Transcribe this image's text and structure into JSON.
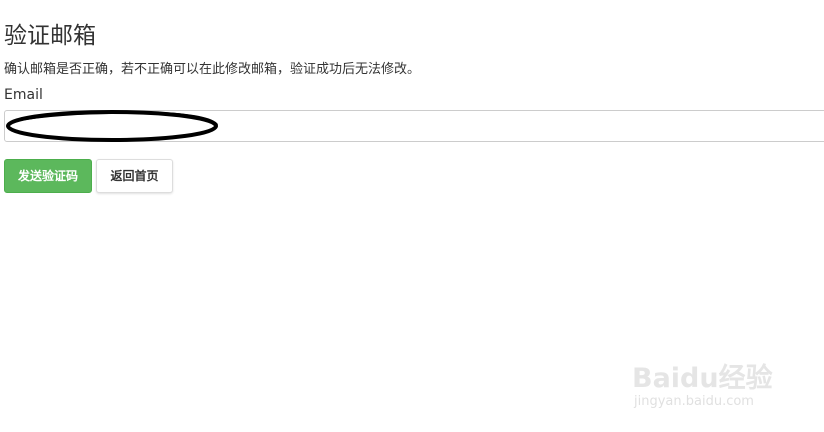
{
  "page": {
    "title": "验证邮箱",
    "description": "确认邮箱是否正确，若不正确可以在此修改邮箱，验证成功后无法修改。"
  },
  "form": {
    "email_label": "Email",
    "email_value": "",
    "email_placeholder": ""
  },
  "buttons": {
    "send_code": "发送验证码",
    "back_home": "返回首页"
  },
  "watermark": {
    "logo_text": "Baidu经验",
    "url_text": "jingyan.baidu.com"
  },
  "colors": {
    "primary_button": "#5cb85c",
    "text": "#333333",
    "border": "#cccccc"
  }
}
